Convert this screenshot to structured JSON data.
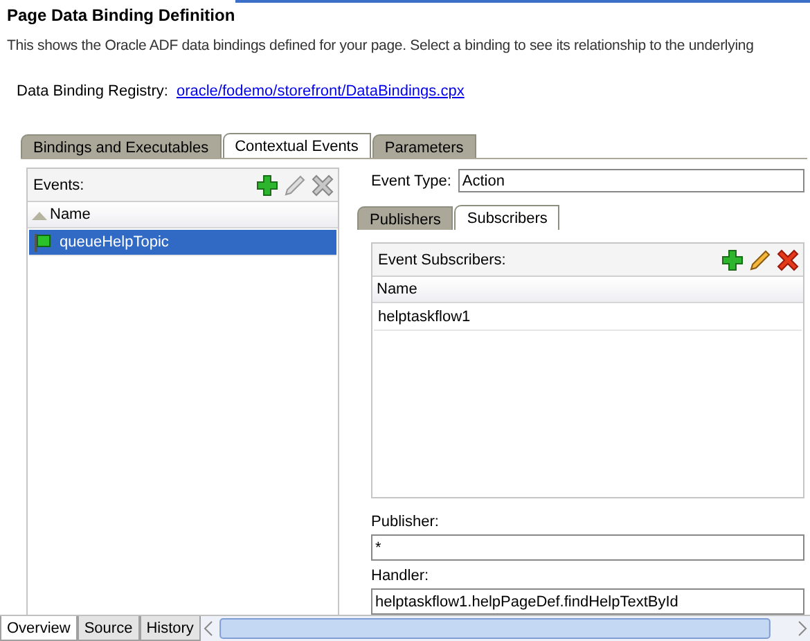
{
  "title": "Page Data Binding Definition",
  "description": "This shows the Oracle ADF data bindings defined for your page. Select a binding to see its relationship to the underlying",
  "registry": {
    "label": "Data Binding Registry:",
    "link": "oracle/fodemo/storefront/DataBindings.cpx"
  },
  "tabs": [
    {
      "label": "Bindings and Executables",
      "selected": false
    },
    {
      "label": "Contextual Events",
      "selected": true
    },
    {
      "label": "Parameters",
      "selected": false
    }
  ],
  "events_panel": {
    "label": "Events:",
    "actions": [
      {
        "kind": "add",
        "disabled": false
      },
      {
        "kind": "edit",
        "disabled": true
      },
      {
        "kind": "delete",
        "disabled": true
      }
    ],
    "column": "Name",
    "rows": [
      {
        "name": "queueHelpTopic",
        "selected": true
      }
    ]
  },
  "event_type": {
    "label": "Event Type:",
    "value": "Action"
  },
  "subtabs": [
    {
      "label": "Publishers",
      "selected": false
    },
    {
      "label": "Subscribers",
      "selected": true
    }
  ],
  "subscribers_panel": {
    "label": "Event Subscribers:",
    "actions": [
      {
        "kind": "add",
        "disabled": false
      },
      {
        "kind": "edit",
        "disabled": false
      },
      {
        "kind": "delete",
        "disabled": false
      }
    ],
    "column": "Name",
    "rows": [
      {
        "name": "helptaskflow1",
        "selected": false
      }
    ]
  },
  "publisher": {
    "label": "Publisher:",
    "value": "*"
  },
  "handler": {
    "label": "Handler:",
    "value": "helptaskflow1.helpPageDef.findHelpTextById"
  },
  "bottom_tabs": [
    {
      "label": "Overview",
      "selected": true
    },
    {
      "label": "Source",
      "selected": false
    },
    {
      "label": "History",
      "selected": false
    }
  ]
}
